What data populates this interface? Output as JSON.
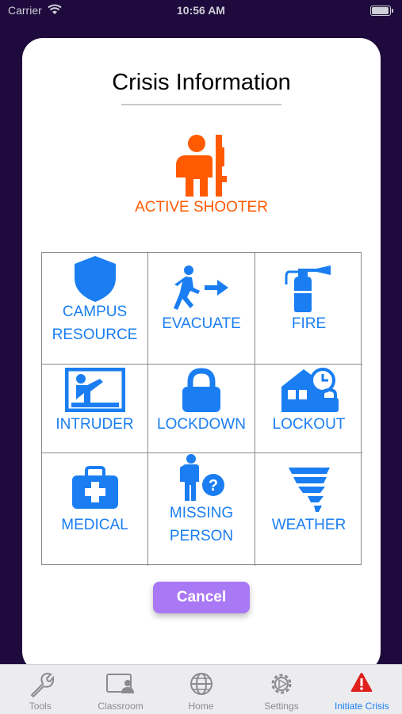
{
  "status_bar": {
    "carrier": "Carrier",
    "time": "10:56 AM"
  },
  "modal": {
    "title": "Crisis Information",
    "active_crisis": {
      "label": "ACTIVE SHOOTER",
      "icon": "active-shooter-icon",
      "color": "#ff5a00"
    },
    "options": [
      {
        "line1": "CAMPUS",
        "line2": "RESOURCE",
        "icon": "shield-icon"
      },
      {
        "line1": "EVACUATE",
        "line2": "",
        "icon": "evacuate-icon"
      },
      {
        "line1": "FIRE",
        "line2": "",
        "icon": "fire-extinguisher-icon"
      },
      {
        "line1": "INTRUDER",
        "line2": "",
        "icon": "intruder-icon"
      },
      {
        "line1": "LOCKDOWN",
        "line2": "",
        "icon": "lock-icon"
      },
      {
        "line1": "LOCKOUT",
        "line2": "",
        "icon": "lockout-building-icon"
      },
      {
        "line1": "MEDICAL",
        "line2": "",
        "icon": "medical-kit-icon"
      },
      {
        "line1": "MISSING",
        "line2": "PERSON",
        "icon": "missing-person-icon"
      },
      {
        "line1": "WEATHER",
        "line2": "",
        "icon": "tornado-icon"
      }
    ],
    "option_color": "#1a7ef2",
    "cancel_label": "Cancel",
    "cancel_color": "#a978f5"
  },
  "tab_bar": {
    "tabs": [
      {
        "label": "Tools",
        "icon": "wrench-icon",
        "active": false
      },
      {
        "label": "Classroom",
        "icon": "classroom-icon",
        "active": false
      },
      {
        "label": "Home",
        "icon": "globe-icon",
        "active": false
      },
      {
        "label": "Settings",
        "icon": "gear-icon",
        "active": false
      },
      {
        "label": "Initiate Crisis",
        "icon": "alert-triangle-icon",
        "active": true
      }
    ],
    "active_color": "#1a7ef2",
    "alert_color": "#e0201c"
  },
  "background_color": "#1e0a3c"
}
